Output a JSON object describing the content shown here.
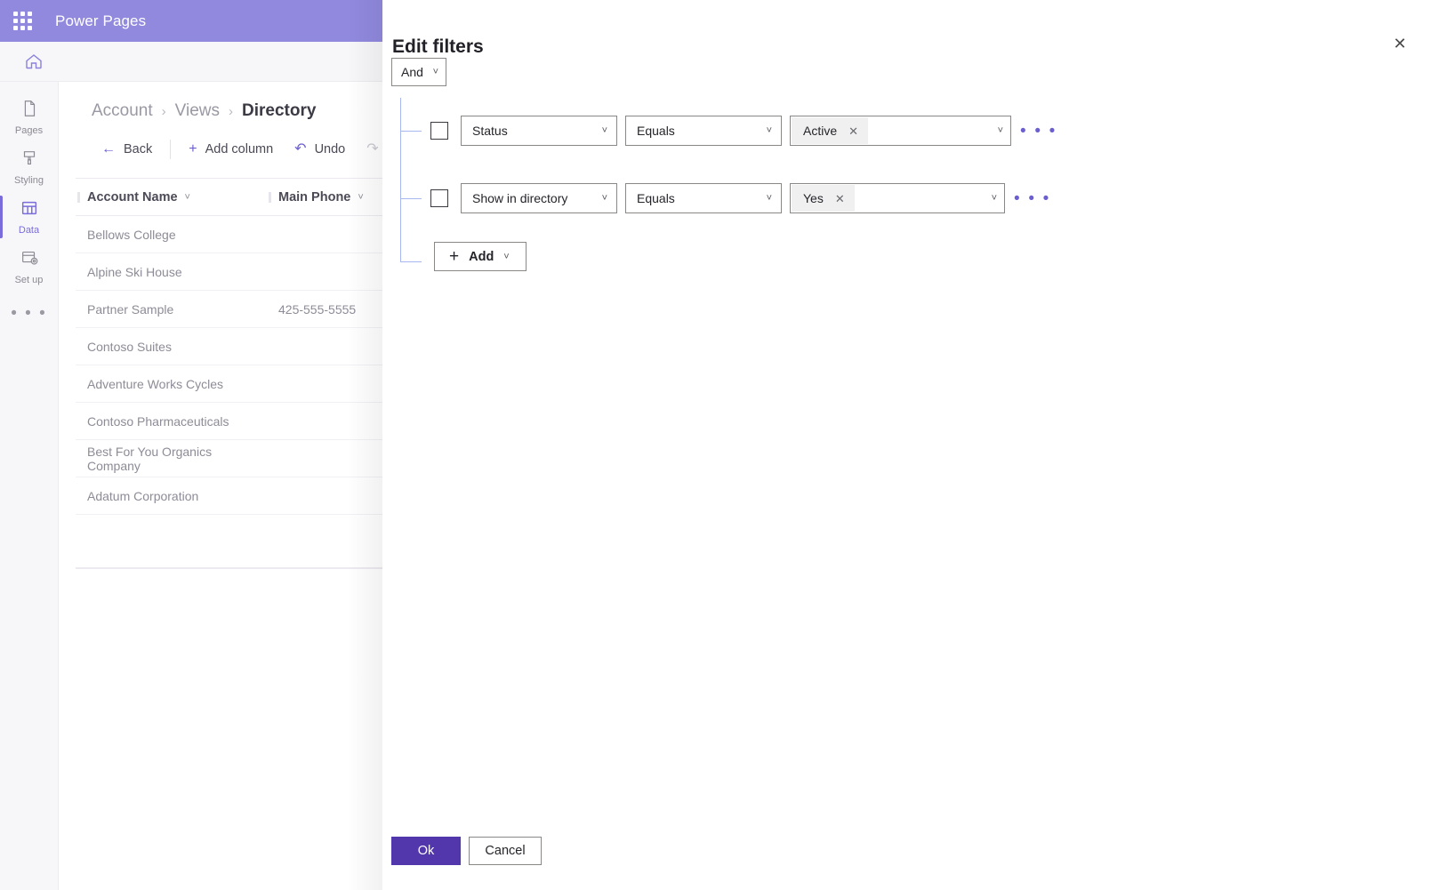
{
  "topbar": {
    "waffle_icon": "app-launcher-icon",
    "title": "Power Pages"
  },
  "secondbar": {
    "home_icon": "home-icon"
  },
  "rail": {
    "items": [
      {
        "label": "Pages",
        "icon": "page-icon",
        "active": false
      },
      {
        "label": "Styling",
        "icon": "brush-icon",
        "active": false
      },
      {
        "label": "Data",
        "icon": "table-icon",
        "active": true
      },
      {
        "label": "Set up",
        "icon": "setup-icon",
        "active": false
      }
    ],
    "more_label": "• • •"
  },
  "breadcrumb": {
    "items": [
      "Account",
      "Views",
      "Directory"
    ],
    "separator": "›"
  },
  "commandbar": {
    "back": "Back",
    "add_column": "Add column",
    "undo": "Undo",
    "redo": "Redo"
  },
  "grid": {
    "columns": [
      "Account Name",
      "Main Phone"
    ],
    "rows": [
      {
        "account_name": "Bellows College",
        "main_phone": ""
      },
      {
        "account_name": "Alpine Ski House",
        "main_phone": ""
      },
      {
        "account_name": "Partner Sample",
        "main_phone": "425-555-5555"
      },
      {
        "account_name": "Contoso Suites",
        "main_phone": ""
      },
      {
        "account_name": "Adventure Works Cycles",
        "main_phone": ""
      },
      {
        "account_name": "Contoso Pharmaceuticals",
        "main_phone": ""
      },
      {
        "account_name": "Best For You Organics Company",
        "main_phone": ""
      },
      {
        "account_name": "Adatum Corporation",
        "main_phone": ""
      }
    ]
  },
  "panel": {
    "title": "Edit filters",
    "close_icon": "close-icon",
    "group_operator": "And",
    "rows": [
      {
        "column": "Status",
        "operator": "Equals",
        "value": "Active",
        "checked": false
      },
      {
        "column": "Show in directory",
        "operator": "Equals",
        "value": "Yes",
        "checked": false
      }
    ],
    "add_label": "Add",
    "row_menu_label": "• • •",
    "ok_label": "Ok",
    "cancel_label": "Cancel"
  },
  "colors": {
    "topbar_purple": "#9189DE",
    "accent_purple": "#6B5FD0",
    "primary_button": "#5236AB",
    "tree_line": "#A7B8F1",
    "chip_bg": "#F0F0F0"
  }
}
